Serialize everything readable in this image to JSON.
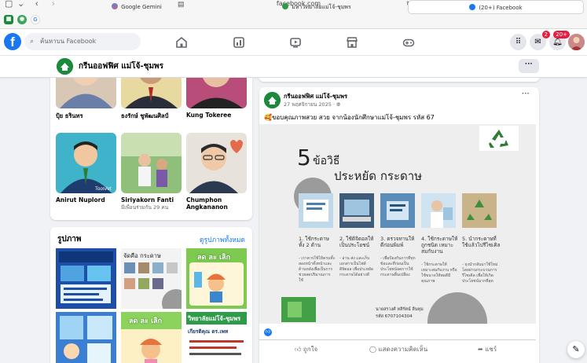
{
  "browser": {
    "url": "facebook.com",
    "tabs": [
      {
        "label": "Google Gemini"
      },
      {
        "label": "มหาวิทยาลัยแม่โจ้-ชุมพร"
      },
      {
        "label": "(20+) Facebook"
      }
    ]
  },
  "topbar": {
    "logo": "f",
    "search_placeholder": "ค้นหาบน Facebook",
    "messenger_badge": "2",
    "notifications_badge": "20+"
  },
  "page": {
    "name": "กรีนออฟฟิศ แม่โจ้-ชุมพร",
    "more": "···"
  },
  "friends": [
    {
      "name": "ปุ้ย ธรินทร",
      "sub": ""
    },
    {
      "name": "ธงรักษ์ ชูพัฒนศิลป์",
      "sub": ""
    },
    {
      "name": "Kung Tokeree",
      "sub": ""
    },
    {
      "name": "Anirut Nuplord",
      "sub": ""
    },
    {
      "name": "Siriyakorn Fanti",
      "sub": "มีเพื่อนร่วมกัน 29 คน"
    },
    {
      "name": "Chumphon",
      "sub": "Angkananon"
    }
  ],
  "photos": {
    "title": "รูปภาพ",
    "see_all": "ดูรูปภาพทั้งหมด"
  },
  "post": {
    "author": "กรีนออฟฟิศ แม่โจ้-ชุมพร",
    "date": "27 พฤศจิกายน 2025 · ",
    "text": "🥰ขอบคุณภาพสวย สวย จากน้องนักศึกษาแม่โจ้-ชุมพร รหัส 67",
    "infographic": {
      "title_number": "5",
      "title_top": "ข้อวิธี",
      "title_bottom": "ประหยัด กระดาษ",
      "steps": [
        {
          "title": "1. ใช้กระดาษทั้ง 2 ด้าน",
          "body": "- เราควรใช้ให้ครบทั้งสองหน้าทั้งหน้าและด้านหลังเพื่อเป็นการช่วยลดปริมาณการใช้"
        },
        {
          "title": "2. ใช้ดิจิตอลให้เป็นประโยชน์",
          "body": "- อ่าน ส่ง และเก็บเอกสารเป็นไฟล์ดิจิตอล เพื่อประหยัดกระดาษได้อย่างดี"
        },
        {
          "title": "3. ตรวจทานให้ดีก่อนพิมพ์",
          "body": "- เพื่อป้องกันการที่ทุกข้อและที่ก่อนเป็นประโยชน์ลดการใช้กระดาษสิ้นเปลือง"
        },
        {
          "title": "4. ใช้กระดาษให้ถูกชนิด เหมาะสมกับงาน",
          "body": "- ใช้กระดาษให้เหมาะสมกับงาน หรือใช้ขนาดให้พอดีมีคุณภาพ"
        },
        {
          "title": "5. นำกระดาษที่ใช้แล้วไปรีไซเคิล",
          "body": "- ถุงนำกลับมาใช้ใหม่ โดยผ่านกระบวนการรีไซเคิล เพื่อให้เกิดประโยชน์มากที่สุด"
        }
      ],
      "credit_name": "นายสรวงศ์ หลีรัตน์ ลีนทุม",
      "credit_id": "รหัส 6707104304"
    },
    "like": "ถูกใจ",
    "comment": "แสดงความคิดเห็น",
    "share": "แชร์"
  },
  "photo_texts": {
    "p2_title": "จัดคือ กระดาษ",
    "p3_title": "ลด ละ เลิก",
    "p5_title": "ลด ละ เลิก",
    "p6_title": "วิทยาลัยแม่โจ้-ชุมพร",
    "p6_sub": "เกียรติคุณ ดร.เพท"
  },
  "colors": {
    "fb_blue": "#1877f2",
    "page_green": "#1b8a3d",
    "badge_red": "#e41e3f"
  }
}
